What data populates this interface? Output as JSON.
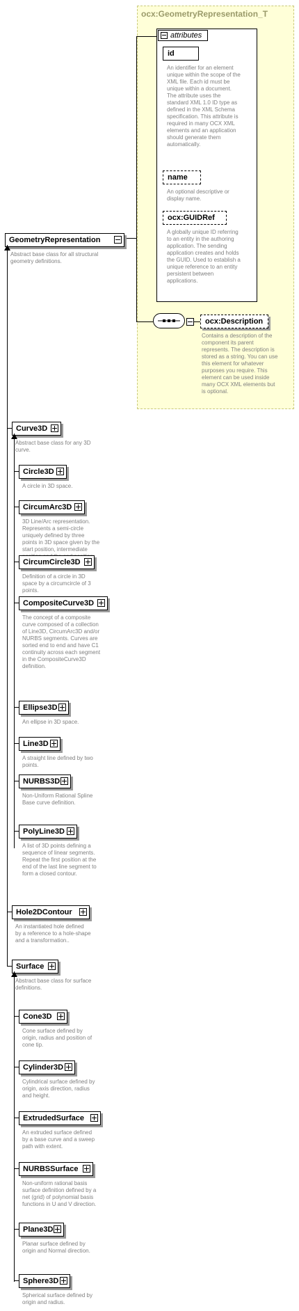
{
  "type_box": {
    "title": "ocx:GeometryRepresentation_T"
  },
  "attributes": {
    "header": "attributes",
    "items": [
      {
        "name": "id",
        "desc": [
          "An identifier for an element",
          "unique within the scope of the",
          "XML file. Each id must be",
          "unique within a document.",
          "The attribute uses the",
          "standard XML 1.0 ID type as",
          "defined in the XML Schema",
          "specification. This attribute is",
          "required in many OCX XML",
          "elements and an application",
          "should generate them",
          "automatically."
        ]
      },
      {
        "name": "name",
        "desc": [
          "An optional descriptive or",
          "display name."
        ]
      },
      {
        "name": "ocx:GUIDRef",
        "desc": [
          "A globally unique ID referring",
          "to an entity in the authoring",
          "application. The sending",
          "application creates and holds",
          "the GUID. Used to establish a",
          "unique reference to an entity",
          "persistent  between",
          "applications."
        ]
      }
    ]
  },
  "sequence": {
    "element": "ocx:Description",
    "desc": [
      "Contains a description of the",
      "component its parent",
      "represents. The description is",
      "stored as a string. You can use",
      "this element for whatever",
      "purposes you require. This",
      "element can be used inside",
      "many OCX XML elements but",
      "is optional."
    ]
  },
  "root": {
    "name": "GeometryRepresentation",
    "desc": [
      "Abstract base class for all structural",
      "geometry definitions."
    ]
  },
  "curve3d": {
    "name": "Curve3D",
    "desc": [
      "Abstract base class for any 3D",
      "curve."
    ]
  },
  "curve_children": [
    {
      "name": "Circle3D",
      "desc": [
        "A circle in 3D space."
      ]
    },
    {
      "name": "CircumArc3D",
      "desc": [
        "3D Line/Arc representation.",
        "Represents a semi-circle",
        "uniquely defined by three",
        "points in 3D space given by the",
        "start position, intermediate",
        "position and the end position.."
      ]
    },
    {
      "name": "CircumCircle3D",
      "desc": [
        "Definition of a circle in 3D",
        "space by a circumcircle of 3",
        "points."
      ]
    },
    {
      "name": "CompositeCurve3D",
      "desc": [
        "The concept of a composite",
        "curve composed of a collection",
        "of Line3D, CircumArc3D and/or",
        "NURBS segments. Curves are",
        "sorted end to end and have C1",
        "continuity across each segment",
        "in the CompositeCurve3D",
        "definition."
      ]
    },
    {
      "name": "Ellipse3D",
      "desc": [
        "An ellipse in 3D space."
      ]
    },
    {
      "name": "Line3D",
      "desc": [
        "A straight line defined by two",
        "points."
      ]
    },
    {
      "name": "NURBS3D",
      "desc": [
        "Non-Uniform Rational Spline",
        "Base curve definition."
      ]
    },
    {
      "name": "PolyLine3D",
      "desc": [
        "A list of 3D points defining a",
        "sequence of linear segments.",
        "Repeat the first position at the",
        "end of the last line segment to",
        "form a closed contour."
      ]
    }
  ],
  "hole": {
    "name": "Hole2DContour",
    "desc": [
      "An instantiated hole defined",
      "by a reference to a hole-shape",
      "and a transformation.."
    ]
  },
  "surface": {
    "name": "Surface",
    "desc": [
      "Abstract base class for surface",
      "definitions."
    ]
  },
  "surface_children": [
    {
      "name": "Cone3D",
      "desc": [
        "Cone surface defined by",
        "origin, radius and position of",
        "cone tip."
      ]
    },
    {
      "name": "Cylinder3D",
      "desc": [
        "Cylindrical surface defined by",
        "origin, axis direction, radius",
        "and height."
      ]
    },
    {
      "name": "ExtrudedSurface",
      "desc": [
        "An extruded surface defined",
        "by a base curve and a sweep",
        "path with extent."
      ]
    },
    {
      "name": "NURBSSurface",
      "desc": [
        "Non-uniform rational basis",
        "surface definition defined by a",
        "net (grid) of polynomial basis",
        "functions  in U and V direction."
      ]
    },
    {
      "name": "Plane3D",
      "desc": [
        "Planar surface defined by",
        "origin and Normal direction."
      ]
    },
    {
      "name": "Sphere3D",
      "desc": [
        "Spherical surface defined by",
        "origin and radius."
      ]
    }
  ]
}
